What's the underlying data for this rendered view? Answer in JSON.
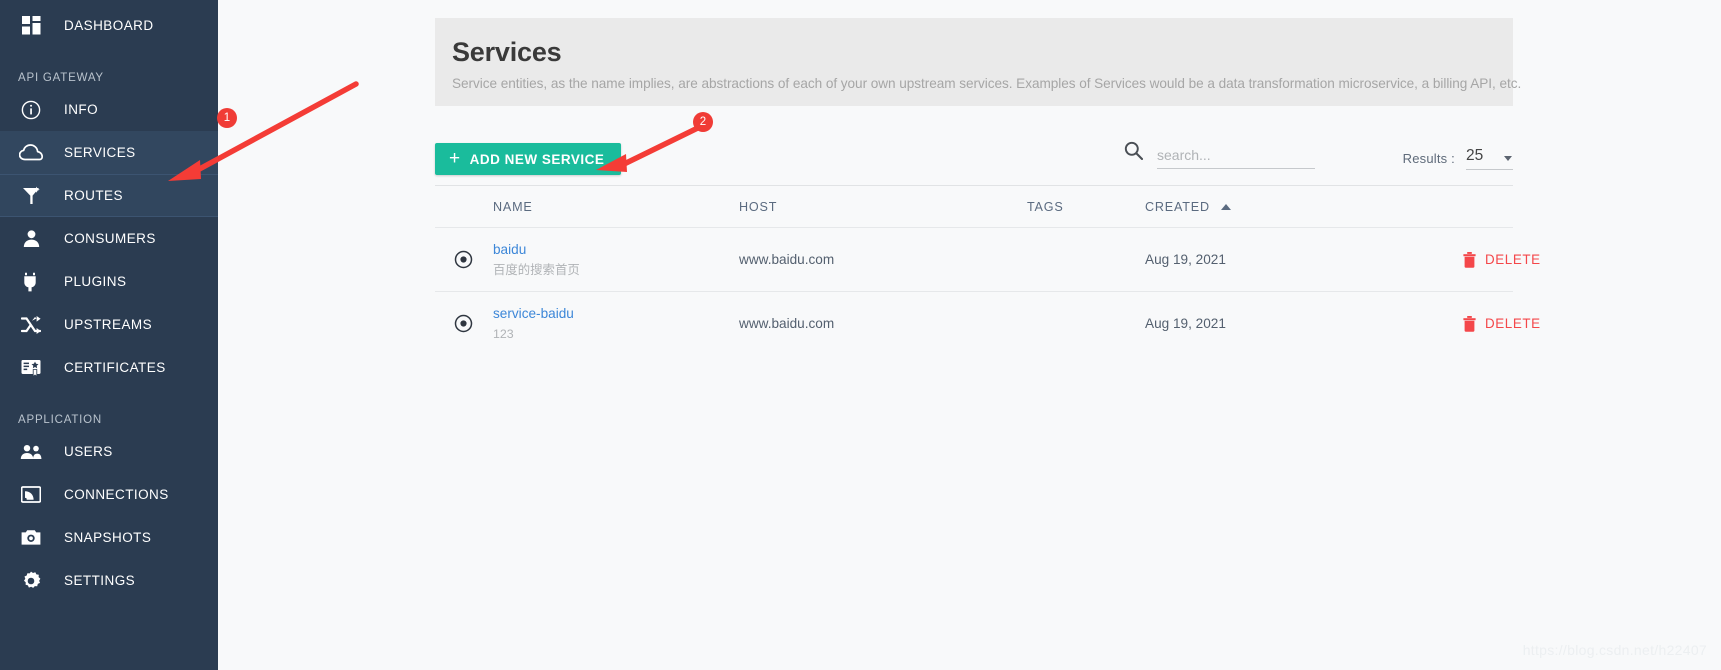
{
  "sidebar": {
    "top_items": [
      {
        "label": "DASHBOARD",
        "icon": "dashboard-icon",
        "state": "normal"
      }
    ],
    "sections": [
      {
        "title": "API GATEWAY",
        "items": [
          {
            "label": "INFO",
            "icon": "info-icon",
            "state": "normal"
          },
          {
            "label": "SERVICES",
            "icon": "cloud-icon",
            "state": "active"
          },
          {
            "label": "ROUTES",
            "icon": "routes-icon",
            "state": "active-2"
          },
          {
            "label": "CONSUMERS",
            "icon": "user-icon",
            "state": "normal"
          },
          {
            "label": "PLUGINS",
            "icon": "plug-icon",
            "state": "normal"
          },
          {
            "label": "UPSTREAMS",
            "icon": "shuffle-icon",
            "state": "normal"
          },
          {
            "label": "CERTIFICATES",
            "icon": "certificate-icon",
            "state": "normal"
          }
        ]
      },
      {
        "title": "APPLICATION",
        "items": [
          {
            "label": "USERS",
            "icon": "users-icon",
            "state": "normal"
          },
          {
            "label": "CONNECTIONS",
            "icon": "cast-icon",
            "state": "normal"
          },
          {
            "label": "SNAPSHOTS",
            "icon": "camera-icon",
            "state": "normal"
          },
          {
            "label": "SETTINGS",
            "icon": "gear-icon",
            "state": "normal"
          }
        ]
      }
    ]
  },
  "panel": {
    "title": "Services",
    "description": "Service entities, as the name implies, are abstractions of each of your own upstream services. Examples of Services would be a data transformation microservice, a billing API, etc."
  },
  "toolbar": {
    "add_button_label": "ADD NEW SERVICE",
    "add_button_plus": "+",
    "search_placeholder": "search...",
    "search_value": "",
    "results_label": "Results :",
    "results_value": "25"
  },
  "table": {
    "columns": [
      "NAME",
      "HOST",
      "TAGS",
      "CREATED"
    ],
    "sort_column": "CREATED",
    "sort_direction": "asc",
    "rows": [
      {
        "name": "baidu",
        "subtitle": "百度的搜索首页",
        "host": "www.baidu.com",
        "tags": "",
        "created": "Aug 19, 2021",
        "delete_label": "DELETE"
      },
      {
        "name": "service-baidu",
        "subtitle": "123",
        "host": "www.baidu.com",
        "tags": "",
        "created": "Aug 19, 2021",
        "delete_label": "DELETE"
      }
    ]
  },
  "annotations": [
    {
      "number": "1"
    },
    {
      "number": "2"
    }
  ],
  "watermark": "https://blog.csdn.net/h22407",
  "colors": {
    "sidebar_bg": "#2b3c51",
    "sidebar_active": "#32475f",
    "accent_green": "#1abc9c",
    "link_blue": "#3d87d8",
    "delete_red": "#f4474a",
    "annotation_red": "#f03c36",
    "panel_bg": "#eaeaea"
  }
}
